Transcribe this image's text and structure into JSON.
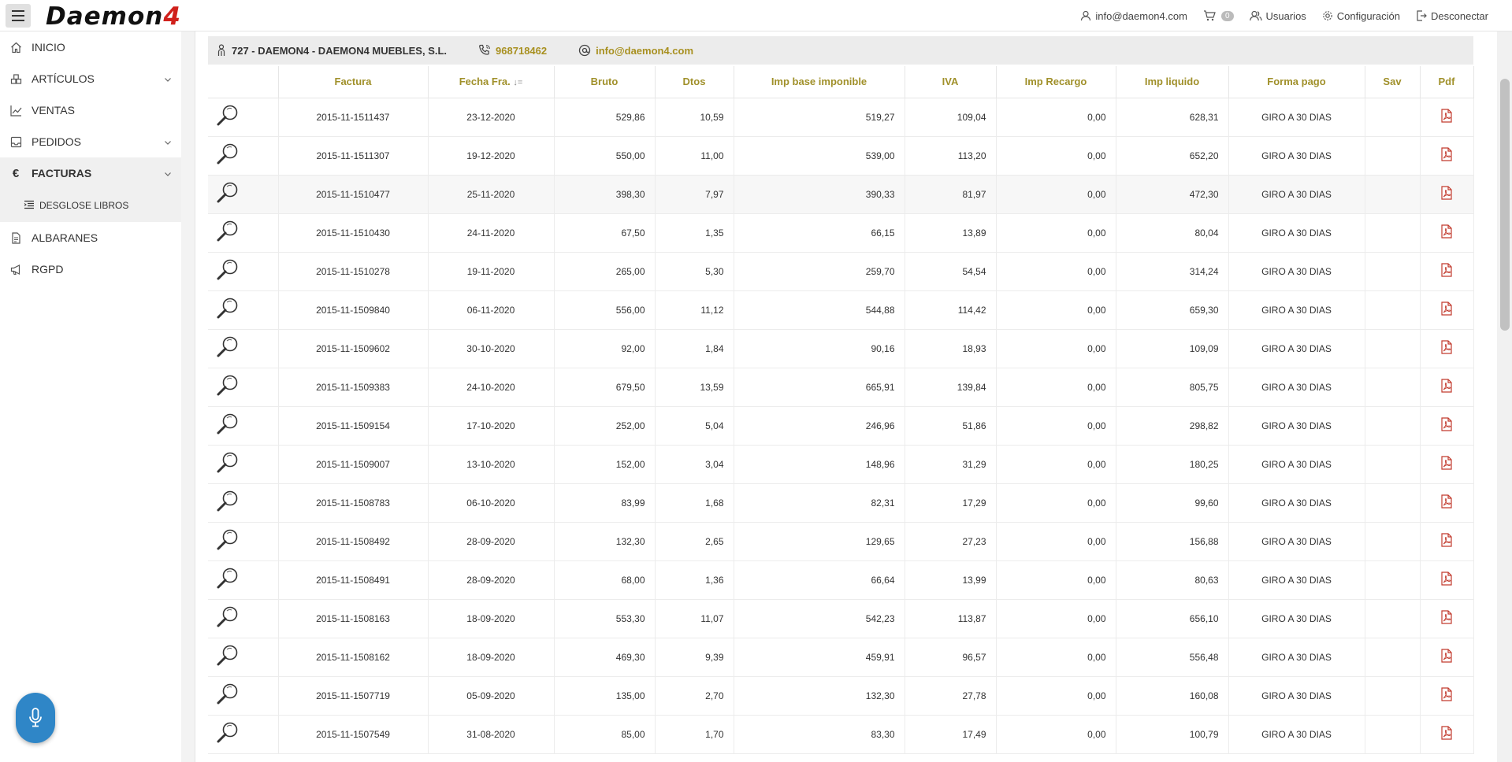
{
  "header": {
    "logo_main": "Daemon",
    "logo_num": "4",
    "email": "info@daemon4.com",
    "cart_count": "0",
    "users_label": "Usuarios",
    "config_label": "Configuración",
    "logout_label": "Desconectar"
  },
  "sidebar": {
    "inicio": "INICIO",
    "articulos": "ARTÍCULOS",
    "ventas": "VENTAS",
    "pedidos": "PEDIDOS",
    "facturas": "FACTURAS",
    "desglose": "DESGLOSE LIBROS",
    "albaranes": "ALBARANES",
    "rgpd": "RGPD"
  },
  "client": {
    "name": "727 - DAEMON4 - DAEMON4 MUEBLES, S.L.",
    "phone": "968718462",
    "email": "info@daemon4.com"
  },
  "table": {
    "headers": [
      "",
      "Factura",
      "Fecha Fra.",
      "Bruto",
      "Dtos",
      "Imp base imponible",
      "IVA",
      "Imp Recargo",
      "Imp liquido",
      "Forma pago",
      "Sav",
      "Pdf"
    ],
    "sort_icon": "↓=",
    "rows": [
      [
        "2015-11-1511437",
        "23-12-2020",
        "529,86",
        "10,59",
        "519,27",
        "109,04",
        "0,00",
        "628,31",
        "GIRO A 30 DIAS"
      ],
      [
        "2015-11-1511307",
        "19-12-2020",
        "550,00",
        "11,00",
        "539,00",
        "113,20",
        "0,00",
        "652,20",
        "GIRO A 30 DIAS"
      ],
      [
        "2015-11-1510477",
        "25-11-2020",
        "398,30",
        "7,97",
        "390,33",
        "81,97",
        "0,00",
        "472,30",
        "GIRO A 30 DIAS"
      ],
      [
        "2015-11-1510430",
        "24-11-2020",
        "67,50",
        "1,35",
        "66,15",
        "13,89",
        "0,00",
        "80,04",
        "GIRO A 30 DIAS"
      ],
      [
        "2015-11-1510278",
        "19-11-2020",
        "265,00",
        "5,30",
        "259,70",
        "54,54",
        "0,00",
        "314,24",
        "GIRO A 30 DIAS"
      ],
      [
        "2015-11-1509840",
        "06-11-2020",
        "556,00",
        "11,12",
        "544,88",
        "114,42",
        "0,00",
        "659,30",
        "GIRO A 30 DIAS"
      ],
      [
        "2015-11-1509602",
        "30-10-2020",
        "92,00",
        "1,84",
        "90,16",
        "18,93",
        "0,00",
        "109,09",
        "GIRO A 30 DIAS"
      ],
      [
        "2015-11-1509383",
        "24-10-2020",
        "679,50",
        "13,59",
        "665,91",
        "139,84",
        "0,00",
        "805,75",
        "GIRO A 30 DIAS"
      ],
      [
        "2015-11-1509154",
        "17-10-2020",
        "252,00",
        "5,04",
        "246,96",
        "51,86",
        "0,00",
        "298,82",
        "GIRO A 30 DIAS"
      ],
      [
        "2015-11-1509007",
        "13-10-2020",
        "152,00",
        "3,04",
        "148,96",
        "31,29",
        "0,00",
        "180,25",
        "GIRO A 30 DIAS"
      ],
      [
        "2015-11-1508783",
        "06-10-2020",
        "83,99",
        "1,68",
        "82,31",
        "17,29",
        "0,00",
        "99,60",
        "GIRO A 30 DIAS"
      ],
      [
        "2015-11-1508492",
        "28-09-2020",
        "132,30",
        "2,65",
        "129,65",
        "27,23",
        "0,00",
        "156,88",
        "GIRO A 30 DIAS"
      ],
      [
        "2015-11-1508491",
        "28-09-2020",
        "68,00",
        "1,36",
        "66,64",
        "13,99",
        "0,00",
        "80,63",
        "GIRO A 30 DIAS"
      ],
      [
        "2015-11-1508163",
        "18-09-2020",
        "553,30",
        "11,07",
        "542,23",
        "113,87",
        "0,00",
        "656,10",
        "GIRO A 30 DIAS"
      ],
      [
        "2015-11-1508162",
        "18-09-2020",
        "469,30",
        "9,39",
        "459,91",
        "96,57",
        "0,00",
        "556,48",
        "GIRO A 30 DIAS"
      ],
      [
        "2015-11-1507719",
        "05-09-2020",
        "135,00",
        "2,70",
        "132,30",
        "27,78",
        "0,00",
        "160,08",
        "GIRO A 30 DIAS"
      ],
      [
        "2015-11-1507549",
        "31-08-2020",
        "85,00",
        "1,70",
        "83,30",
        "17,49",
        "0,00",
        "100,79",
        "GIRO A 30 DIAS"
      ]
    ]
  }
}
